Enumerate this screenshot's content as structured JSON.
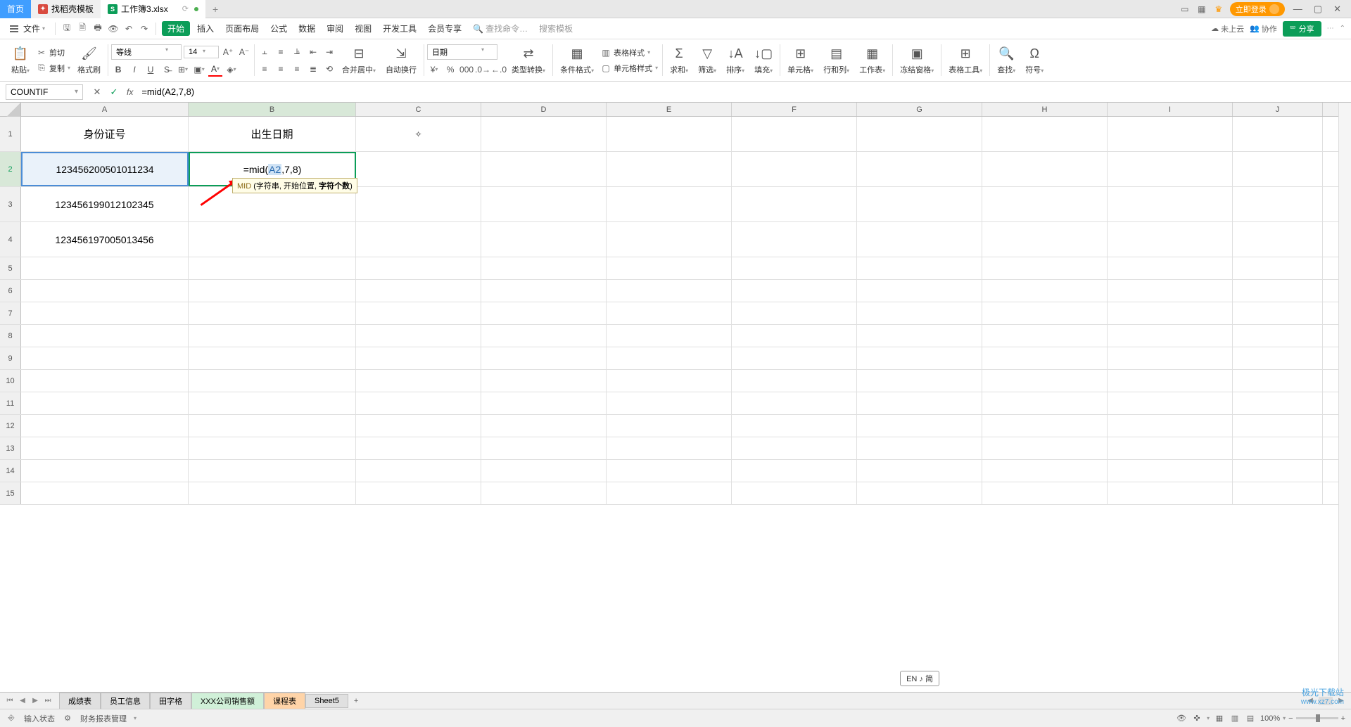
{
  "titlebar": {
    "home_tab": "首页",
    "template_tab": "找稻壳模板",
    "active_tab": "工作簿3.xlsx",
    "login": "立即登录"
  },
  "menubar": {
    "file": "文件",
    "items": [
      "开始",
      "插入",
      "页面布局",
      "公式",
      "数据",
      "审阅",
      "视图",
      "开发工具",
      "会员专享"
    ],
    "search_cmd": "查找命令…",
    "search_tpl": "搜索模板",
    "cloud": "未上云",
    "coop": "协作",
    "share": "分享"
  },
  "ribbon": {
    "paste": "粘贴",
    "cut": "剪切",
    "copy": "复制",
    "brush": "格式刷",
    "font": "等线",
    "fontsize": "14",
    "merge": "合并居中",
    "wrap": "自动换行",
    "format": "日期",
    "type_convert": "类型转换",
    "cond_format": "条件格式",
    "table_style": "表格样式",
    "cell_style": "单元格样式",
    "sum": "求和",
    "filter": "筛选",
    "sort": "排序",
    "fill": "填充",
    "cell": "单元格",
    "rowcol": "行和列",
    "worksheet": "工作表",
    "freeze": "冻结窗格",
    "table_tools": "表格工具",
    "find": "查找",
    "symbol": "符号"
  },
  "formulabar": {
    "name": "COUNTIF",
    "formula": "=mid(A2,7,8)"
  },
  "grid": {
    "cols": [
      "A",
      "B",
      "C",
      "D",
      "E",
      "F",
      "G",
      "H",
      "I",
      "J"
    ],
    "header_a": "身份证号",
    "header_b": "出生日期",
    "a2": "123456200501011234",
    "a3": "123456199012102345",
    "a4": "123456197005013456",
    "b2_prefix": "=mid(",
    "b2_ref": "A2",
    "b2_suffix": ",7,8)",
    "tooltip_func": "MID",
    "tooltip_args": " (字符串, 开始位置, ",
    "tooltip_active": "字符个数",
    "tooltip_end": ")"
  },
  "sheets": {
    "tabs": [
      "成绩表",
      "员工信息",
      "田字格",
      "XXX公司销售额",
      "课程表",
      "Sheet5"
    ]
  },
  "statusbar": {
    "mode": "输入状态",
    "mgmt": "财务报表管理",
    "zoom": "100%"
  },
  "ime": "EN ♪ 简",
  "watermark": {
    "line1": "极光下载站",
    "line2": "www.xz7.com"
  }
}
